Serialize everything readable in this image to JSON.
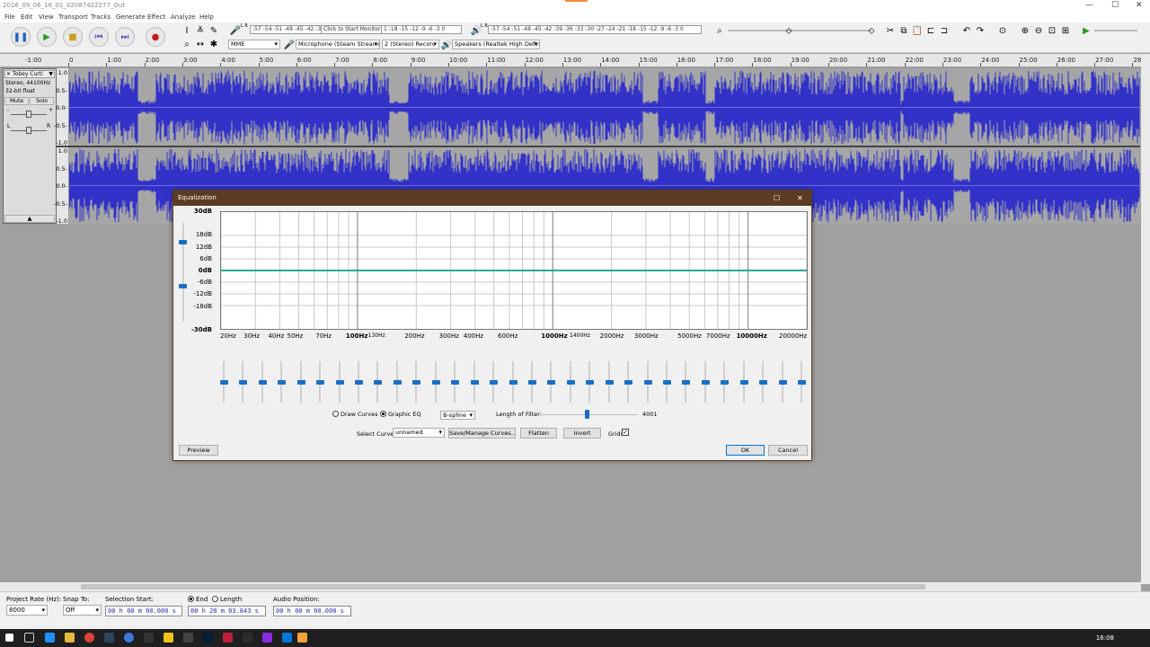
{
  "window": {
    "title": "2016_09_06_16_02_02087422277_Out",
    "minimize": "—",
    "restore": "☐",
    "close": "✕"
  },
  "menu": [
    "File",
    "Edit",
    "View",
    "Transport",
    "Tracks",
    "Generate",
    "Effect",
    "Analyze",
    "Help"
  ],
  "toolbar": {
    "record_meter": "-57 -54 -51 -48 -45 -42 -3",
    "monitor_prompt": "Click to Start Monitoring",
    "record_meter_tail": "1 -18 -15 -12 -9 -6 -3 0",
    "record_meter_lr": "L R",
    "play_meter_lr": "L R",
    "play_meter": "-57 -54 -51 -48 -45 -42 -39 -36 -33 -30 -27 -24 -21 -18 -15 -12 -9 -6 -3 0",
    "host": "MME",
    "recording_device": "Microphone (Steam Streaming",
    "channels": "2 (Stereo) Recorc",
    "playback_device": "Speakers (Realtek High Defini"
  },
  "ruler": {
    "start": "-1:00",
    "labels": [
      "0",
      "1:00",
      "2:00",
      "3:00",
      "4:00",
      "5:00",
      "6:00",
      "7:00",
      "8:00",
      "9:00",
      "10:00",
      "11:00",
      "12:00",
      "13:00",
      "14:00",
      "15:00",
      "16:00",
      "17:00",
      "18:00",
      "19:00",
      "20:00",
      "21:00",
      "22:00",
      "23:00",
      "24:00",
      "25:00",
      "26:00",
      "27:00",
      "28:00"
    ]
  },
  "track": {
    "name": "Tobey Curti",
    "format": "Stereo, 44100Hz",
    "bits": "32-bit float",
    "mute": "Mute",
    "solo": "Solo",
    "gain_minus": "-",
    "gain_plus": "+",
    "pan_l": "L",
    "pan_r": "R",
    "collapse": "▲",
    "close": "✕",
    "menu_arrow": "▼",
    "scale": [
      "1.0",
      "0.5-",
      "0.0-",
      "-0.5-",
      "-1.0"
    ]
  },
  "equalization": {
    "title": "Equalization",
    "maximize": "☐",
    "close": "✕",
    "db_labels": [
      "30dB",
      "18dB",
      "12dB",
      "6dB",
      "0dB",
      "-6dB",
      "-12dB",
      "-18dB",
      "-30dB"
    ],
    "hz_labels": [
      "20Hz",
      "30Hz",
      "40Hz",
      "50Hz",
      "70Hz",
      "100Hz",
      "130Hz",
      "200Hz",
      "300Hz",
      "400Hz",
      "600Hz",
      "1000Hz",
      "1400Hz",
      "2000Hz",
      "3000Hz",
      "5000Hz",
      "7000Hz",
      "10000Hz",
      "20000Hz"
    ],
    "draw_curves": "Draw Curves",
    "graphic_eq": "Graphic EQ",
    "interpolation": "B-spline",
    "length_label": "Length of Filter:",
    "length_value": "4001",
    "length_fraction": 0.45,
    "select_curve_label": "Select Curve:",
    "curve": "unnamed",
    "save_manage": "Save/Manage Curves...",
    "flatten": "Flatten",
    "invert": "Invert",
    "grids": "Grids",
    "grids_checked": "✓",
    "preview": "Preview",
    "ok": "OK",
    "cancel": "Cancel",
    "band_gains_db": [
      0,
      0,
      0,
      0,
      0,
      0,
      0,
      0,
      0,
      0,
      0,
      0,
      0,
      0,
      0,
      0,
      0,
      0,
      0,
      0,
      0,
      0,
      0,
      0,
      0,
      0,
      0,
      0,
      0,
      0,
      0
    ],
    "curve_color": "#2aa89a"
  },
  "statusbar": {
    "project_rate_label": "Project Rate (Hz):",
    "project_rate": "8000",
    "snap_to_label": "Snap To:",
    "snap_to": "Off",
    "selection_start_label": "Selection Start:",
    "selection_start": "00 h 00 m 00.000 s",
    "end_label": "End",
    "length_label": "Length",
    "selection_end": "00 h 28 m 03.043 s",
    "audio_position_label": "Audio Position:",
    "audio_position": "00 h 00 m 00.000 s"
  },
  "taskbar": {
    "clock": "16:08"
  },
  "colors": {
    "waveform": "#3232c8",
    "dialog_title": "#5b3b22",
    "slider": "#1a6fc4"
  }
}
